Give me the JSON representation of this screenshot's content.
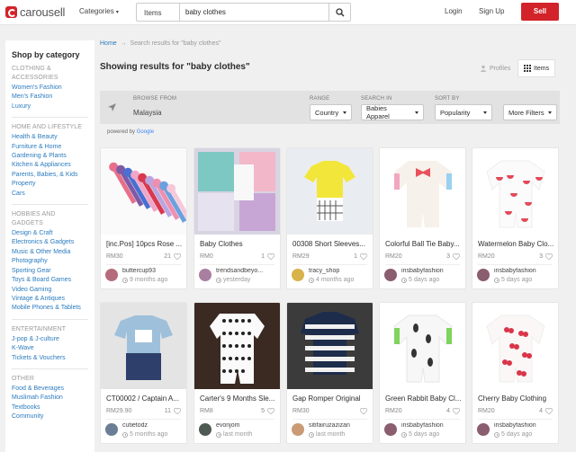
{
  "header": {
    "logo_text": "carousell",
    "categories_label": "Categories",
    "search_type": "Items",
    "search_value": "baby clothes",
    "login": "Login",
    "signup": "Sign Up",
    "sell": "Sell"
  },
  "sidebar": {
    "title": "Shop by category",
    "groups": [
      {
        "head": "CLOTHING & ACCESSORIES",
        "items": [
          "Women's Fashion",
          "Men's Fashion",
          "Luxury"
        ]
      },
      {
        "head": "HOME AND LIFESTYLE",
        "items": [
          "Health & Beauty",
          "Furniture & Home",
          "Gardening & Plants",
          "Kitchen & Appliances",
          "Parents, Babies, & Kids",
          "Property",
          "Cars"
        ]
      },
      {
        "head": "HOBBIES AND GADGETS",
        "items": [
          "Design & Craft",
          "Electronics & Gadgets",
          "Music & Other Media",
          "Photography",
          "Sporting Gear",
          "Toys & Board Games",
          "Video Gaming",
          "Vintage & Antiques",
          "Mobile Phones & Tablets"
        ]
      },
      {
        "head": "ENTERTAINMENT",
        "items": [
          "J-pop & J-culture",
          "K-Wave",
          "Tickets & Vouchers"
        ]
      },
      {
        "head": "OTHER",
        "items": [
          "Food & Beverages",
          "Muslimah Fashion",
          "Textbooks",
          "Community"
        ]
      }
    ]
  },
  "breadcrumb": {
    "home": "Home",
    "sep": "→",
    "current": "Search results for \"baby clothes\""
  },
  "results_title": "Showing results for \"baby clothes\"",
  "view_toggle": {
    "profiles": "Profiles",
    "items": "Items"
  },
  "filters": {
    "browse_from_label": "BROWSE FROM",
    "browse_from_value": "Malaysia",
    "range_label": "RANGE",
    "range_value": "Country",
    "search_in_label": "SEARCH IN",
    "search_in_value": "Babies Apparel",
    "sort_label": "SORT BY",
    "sort_value": "Popularity",
    "more_filters": "More Filters"
  },
  "powered_by": {
    "text": "powered by",
    "brand": "Google"
  },
  "listings": [
    {
      "title": "[inc.Pos] 10pcs Rose ...",
      "price": "RM30",
      "likes": "21",
      "seller": "buttercup93",
      "time": "9 months ago"
    },
    {
      "title": "Baby Clothes",
      "price": "RM0",
      "likes": "1",
      "seller": "trendsandbeyo...",
      "time": "yesterday"
    },
    {
      "title": "00308 Short Sleeves...",
      "price": "RM29",
      "likes": "1",
      "seller": "tracy_shop",
      "time": "4 months ago"
    },
    {
      "title": "Colorful Ball Tie Baby...",
      "price": "RM20",
      "likes": "3",
      "seller": "irisbabyfashion",
      "time": "5 days ago"
    },
    {
      "title": "Watermelon Baby Clo...",
      "price": "RM20",
      "likes": "3",
      "seller": "irisbabyfashion",
      "time": "5 days ago"
    },
    {
      "title": "CT00002 / Captain A...",
      "price": "RM29.90",
      "likes": "11",
      "seller": "cutietodz",
      "time": "5 months ago"
    },
    {
      "title": "Carter's 9 Months Sle...",
      "price": "RM8",
      "likes": "5",
      "seller": "evonjom",
      "time": "last month"
    },
    {
      "title": "Gap Romper Original",
      "price": "RM30",
      "likes": "",
      "seller": "sitifairuzazizan",
      "time": "last month"
    },
    {
      "title": "Green Rabbit Baby Cl...",
      "price": "RM20",
      "likes": "4",
      "seller": "irisbabyfashion",
      "time": "5 days ago"
    },
    {
      "title": "Cherry Baby Clothing",
      "price": "RM20",
      "likes": "4",
      "seller": "irisbabyfashion",
      "time": "5 days ago"
    }
  ],
  "colors": {
    "brand_red": "#d2232a",
    "link_blue": "#2a7bbf",
    "page_bg": "#f0f0f0"
  }
}
